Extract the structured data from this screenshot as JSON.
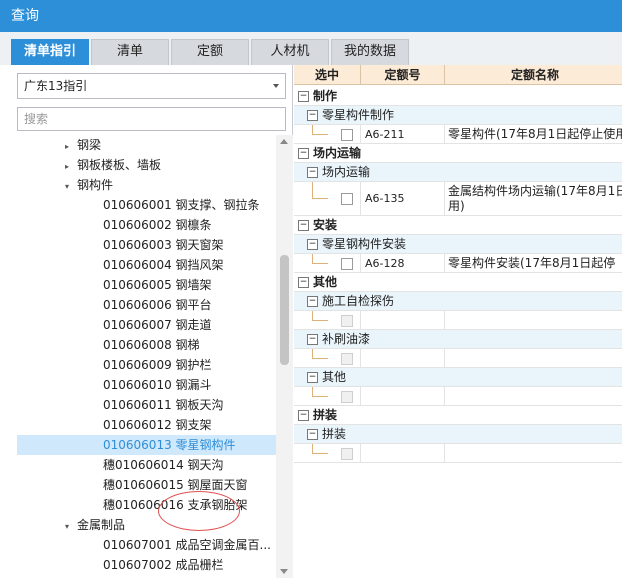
{
  "window": {
    "title": "查询"
  },
  "tabs": [
    {
      "label": "清单指引",
      "active": true
    },
    {
      "label": "清单",
      "active": false
    },
    {
      "label": "定额",
      "active": false
    },
    {
      "label": "人材机",
      "active": false
    },
    {
      "label": "我的数据",
      "active": false
    }
  ],
  "left": {
    "guide_select": "广东13指引",
    "search_placeholder": "搜索",
    "tree": [
      {
        "label": "钢梁",
        "caret": "▸"
      },
      {
        "label": "钢板楼板、墙板",
        "caret": "▸"
      },
      {
        "label": "钢构件",
        "caret": "▾"
      },
      {
        "label": "010606001  钢支撑、钢拉条"
      },
      {
        "label": "010606002  钢檩条"
      },
      {
        "label": "010606003  钢天窗架"
      },
      {
        "label": "010606004  钢挡风架"
      },
      {
        "label": "010606005  钢墙架"
      },
      {
        "label": "010606006  钢平台"
      },
      {
        "label": "010606007  钢走道"
      },
      {
        "label": "010606008  钢梯"
      },
      {
        "label": "010606009  钢护栏"
      },
      {
        "label": "010606010  钢漏斗"
      },
      {
        "label": "010606011  钢板天沟"
      },
      {
        "label": "010606012  钢支架"
      },
      {
        "label": "010606013  零星钢构件",
        "selected": true
      },
      {
        "label": "穗010606014  钢天沟"
      },
      {
        "label": "穗010606015  钢屋面天窗"
      },
      {
        "label": "穗010606016  支承钢胎架"
      },
      {
        "label": "金属制品",
        "caret": "▾"
      },
      {
        "label": "010607001  成品空调金属百..."
      },
      {
        "label": "010607002  成品栅栏"
      }
    ]
  },
  "grid": {
    "headers": {
      "select": "选中",
      "code": "定额号",
      "name": "定额名称"
    },
    "groups": [
      {
        "label": "制作",
        "subgroups": [
          {
            "label": "零星构件制作",
            "rows": [
              {
                "code": "A6-211",
                "name": "零星构件(17年8月1日起停止使用"
              }
            ]
          }
        ]
      },
      {
        "label": "场内运输",
        "subgroups": [
          {
            "label": "场内运输",
            "rows": [
              {
                "code": "A6-135",
                "name": "金属结构件场内运输(17年8月1日",
                "name2": "用)"
              }
            ]
          }
        ]
      },
      {
        "label": "安装",
        "subgroups": [
          {
            "label": "零星钢构件安装",
            "rows": [
              {
                "code": "A6-128",
                "name": "零星构件安装(17年8月1日起停"
              }
            ]
          }
        ]
      },
      {
        "label": "其他",
        "subgroups": [
          {
            "label": "施工自检探伤",
            "rows": [
              {
                "code": "",
                "name": ""
              }
            ]
          },
          {
            "label": "补刷油漆",
            "rows": [
              {
                "code": "",
                "name": ""
              }
            ]
          },
          {
            "label": "其他",
            "rows": [
              {
                "code": "",
                "name": ""
              }
            ]
          }
        ]
      },
      {
        "label": "拼装",
        "subgroups": [
          {
            "label": "拼装",
            "rows": [
              {
                "code": "",
                "name": ""
              }
            ]
          }
        ]
      }
    ]
  }
}
